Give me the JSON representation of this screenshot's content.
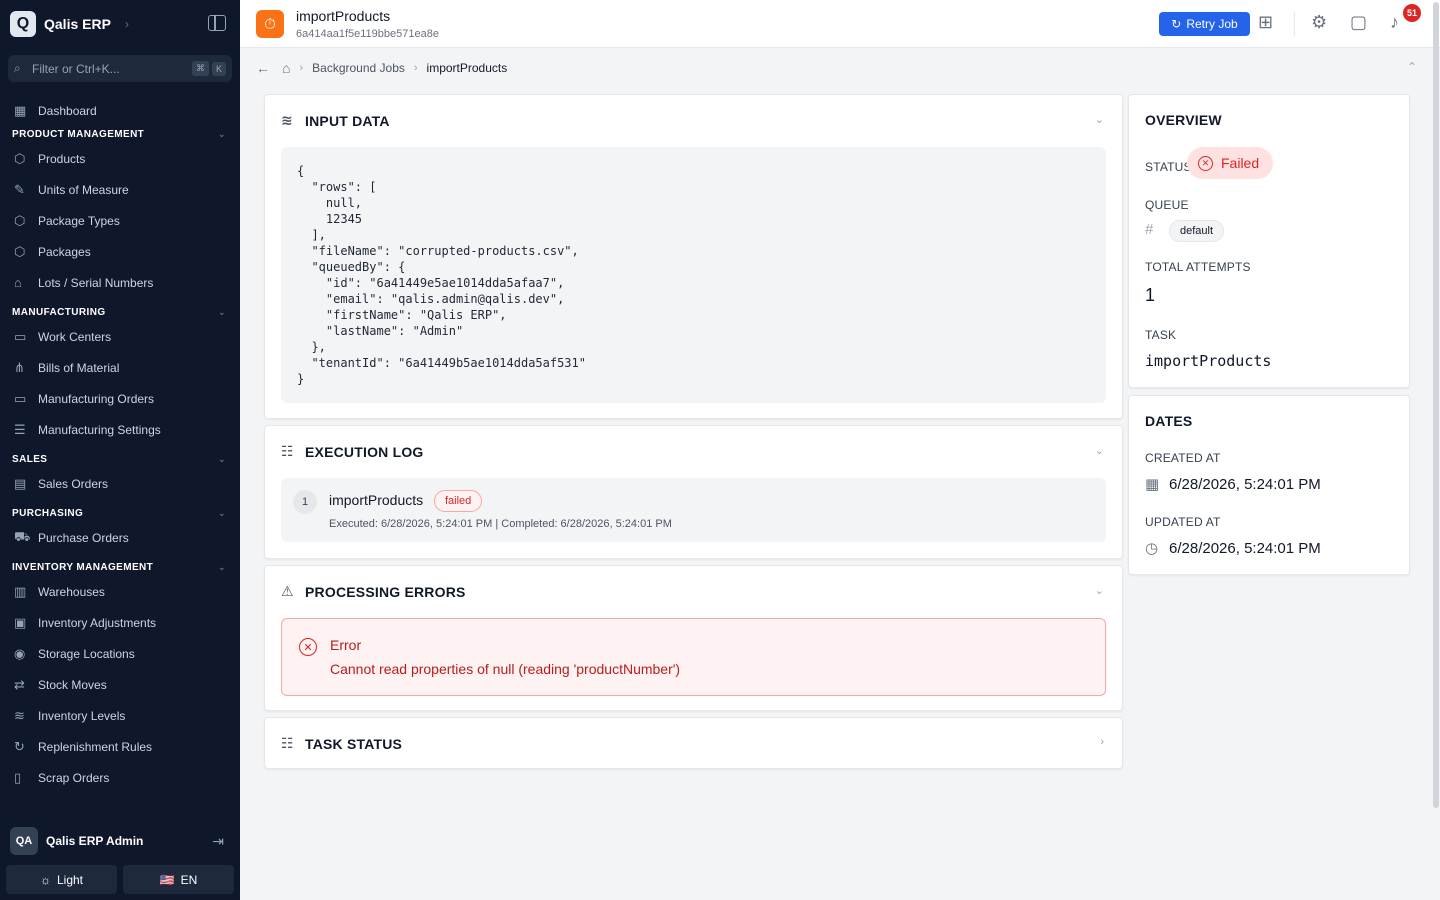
{
  "app": {
    "brand_initial": "Q",
    "brand_name": "Qalis ERP",
    "filter_placeholder": "Filter or Ctrl+K...",
    "filter_keys": [
      "⌘",
      "K"
    ]
  },
  "sidebar": {
    "dashboard": "Dashboard",
    "sections": [
      {
        "title": "PRODUCT MANAGEMENT",
        "items": [
          "Products",
          "Units of Measure",
          "Package Types",
          "Packages",
          "Lots / Serial Numbers"
        ]
      },
      {
        "title": "MANUFACTURING",
        "items": [
          "Work Centers",
          "Bills of Material",
          "Manufacturing Orders",
          "Manufacturing Settings"
        ]
      },
      {
        "title": "SALES",
        "items": [
          "Sales Orders"
        ]
      },
      {
        "title": "PURCHASING",
        "items": [
          "Purchase Orders"
        ]
      },
      {
        "title": "INVENTORY MANAGEMENT",
        "items": [
          "Warehouses",
          "Inventory Adjustments",
          "Storage Locations",
          "Stock Moves",
          "Inventory Levels",
          "Replenishment Rules",
          "Scrap Orders"
        ]
      }
    ],
    "user_initials": "QA",
    "user_name": "Qalis ERP Admin",
    "theme_label": "Light",
    "lang_flag": "🇺🇸",
    "lang_label": "EN"
  },
  "header": {
    "title": "importProducts",
    "job_id": "6a414aa1f5e119bbe571ea8e",
    "retry_label": "Retry Job",
    "notification_count": "51"
  },
  "breadcrumb": {
    "parent": "Background Jobs",
    "current": "importProducts"
  },
  "input_data": {
    "title": "INPUT DATA",
    "json": "{\n  \"rows\": [\n    null,\n    12345\n  ],\n  \"fileName\": \"corrupted-products.csv\",\n  \"queuedBy\": {\n    \"id\": \"6a41449e5ae1014dda5afaa7\",\n    \"email\": \"qalis.admin@qalis.dev\",\n    \"firstName\": \"Qalis ERP\",\n    \"lastName\": \"Admin\"\n  },\n  \"tenantId\": \"6a41449b5ae1014dda5af531\"\n}"
  },
  "execution_log": {
    "title": "EXECUTION LOG",
    "step_number": "1",
    "step_name": "importProducts",
    "step_status": "failed",
    "step_meta": "Executed: 6/28/2026, 5:24:01 PM | Completed: 6/28/2026, 5:24:01 PM"
  },
  "processing_errors": {
    "title": "PROCESSING ERRORS",
    "error_title": "Error",
    "error_message": "Cannot read properties of null (reading 'productNumber')"
  },
  "task_status": {
    "title": "TASK STATUS"
  },
  "overview": {
    "title": "OVERVIEW",
    "status_label": "STATUS",
    "status_value": "Failed",
    "queue_label": "QUEUE",
    "queue_value": "default",
    "attempts_label": "TOTAL ATTEMPTS",
    "attempts_value": "1",
    "task_label": "TASK",
    "task_value": "importProducts"
  },
  "dates": {
    "title": "DATES",
    "created_label": "CREATED AT",
    "created_value": "6/28/2026, 5:24:01 PM",
    "updated_label": "UPDATED AT",
    "updated_value": "6/28/2026, 5:24:01 PM"
  },
  "colors": {
    "sidebar_bg": "#0f172a",
    "accent": "#2563eb",
    "job_icon": "#f97316",
    "error": "#dc2626"
  }
}
